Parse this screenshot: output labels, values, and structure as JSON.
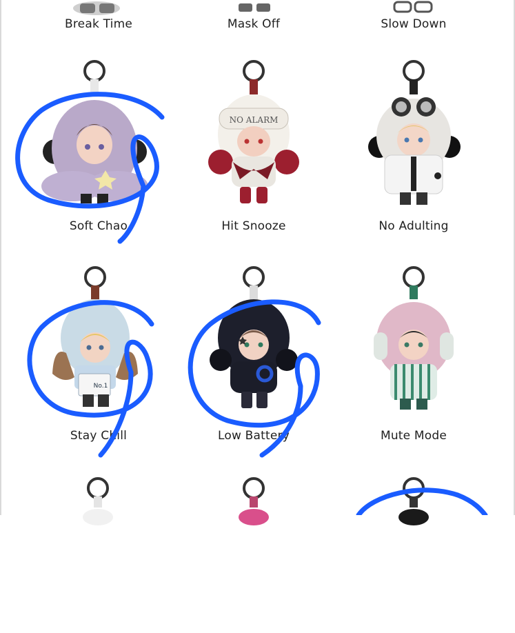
{
  "products": [
    {
      "name": "Break Time"
    },
    {
      "name": "Mask Off"
    },
    {
      "name": "Slow Down"
    },
    {
      "name": "Soft Chao"
    },
    {
      "name": "Hit Snooze"
    },
    {
      "name": "No Adulting"
    },
    {
      "name": "Stay Chill"
    },
    {
      "name": "Low Battery"
    },
    {
      "name": "Mute Mode"
    }
  ],
  "figure_text": {
    "hit_snooze_mask": "NO ALARM",
    "stay_chill_badge": "No.1"
  },
  "colors": {
    "annotation_blue": "#1a5cff",
    "label_text": "#1f1f1f"
  }
}
